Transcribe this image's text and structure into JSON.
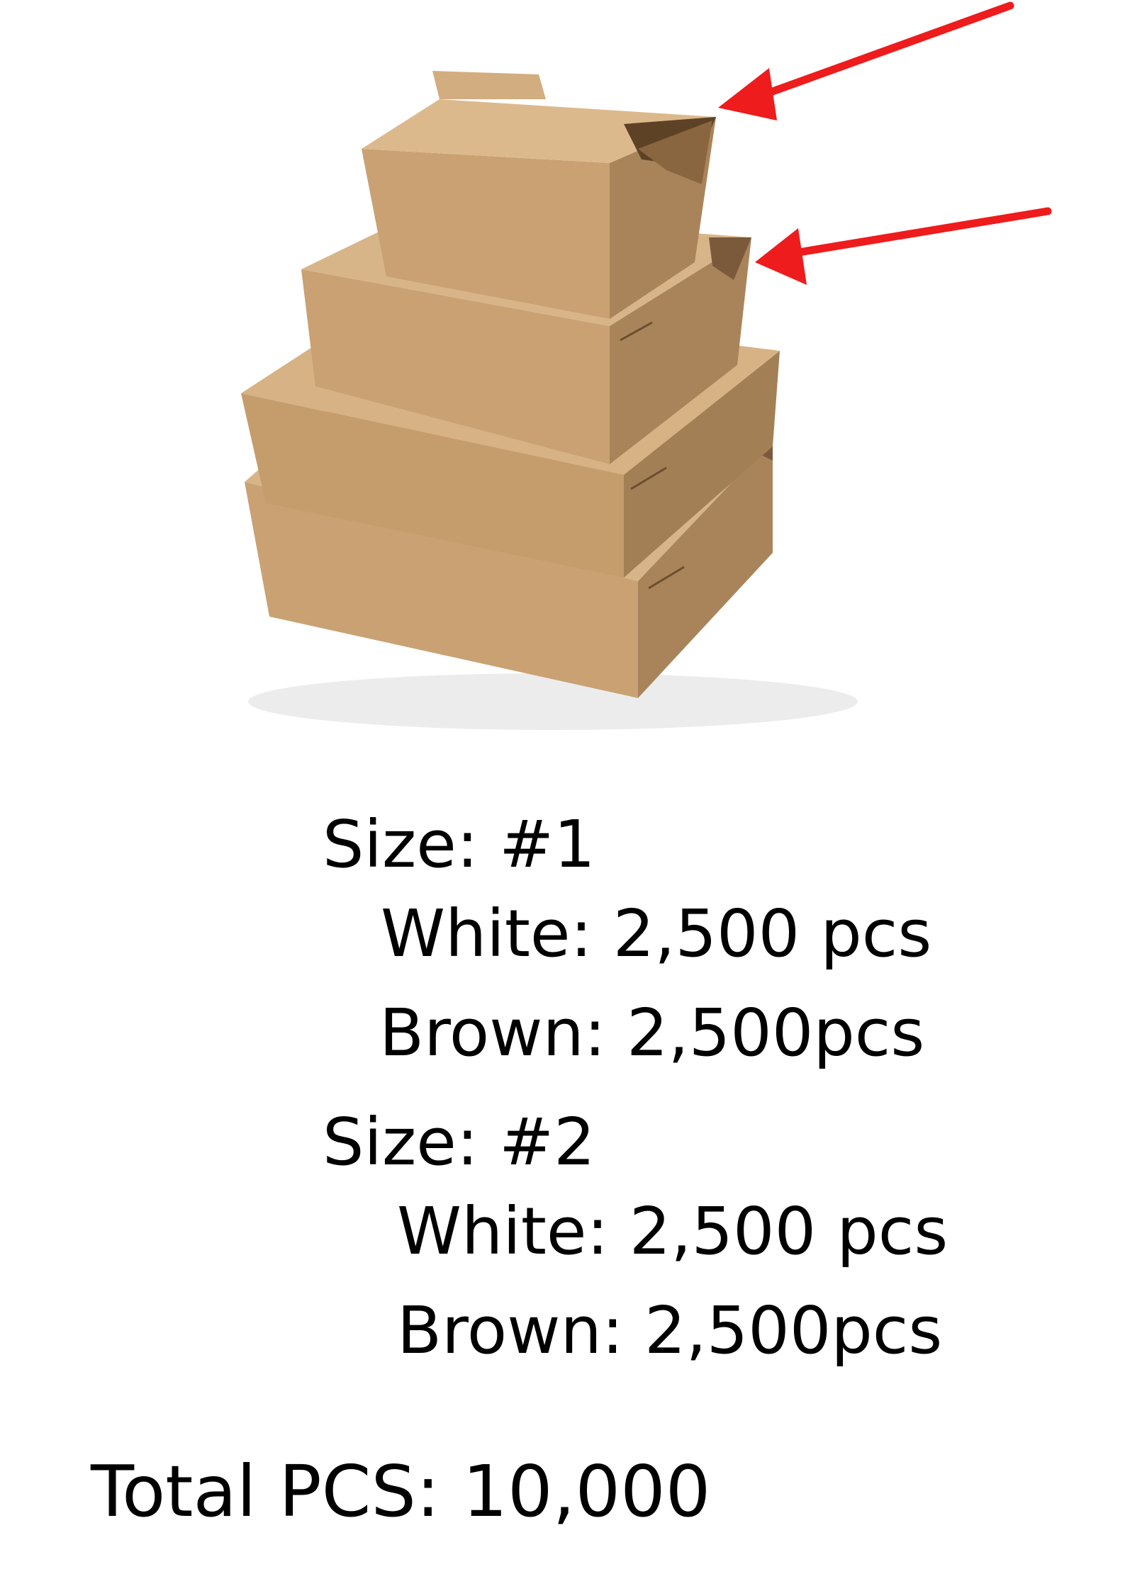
{
  "photo": {
    "subject": "stacked kraft paper takeout boxes",
    "colors": {
      "kraft": "#c9a173",
      "kraft_dark": "#a9845a",
      "kraft_light": "#d8b588",
      "shadow": "#7a5a3a"
    }
  },
  "arrows": {
    "color": "#ee1c1c",
    "count": 2
  },
  "order": {
    "sizes": [
      {
        "heading": "Size: #1",
        "white": "White: 2,500 pcs",
        "brown": "Brown: 2,500pcs"
      },
      {
        "heading": "Size: #2",
        "white": "White: 2,500 pcs",
        "brown": "Brown: 2,500pcs"
      }
    ],
    "total": "Total PCS: 10,000"
  }
}
